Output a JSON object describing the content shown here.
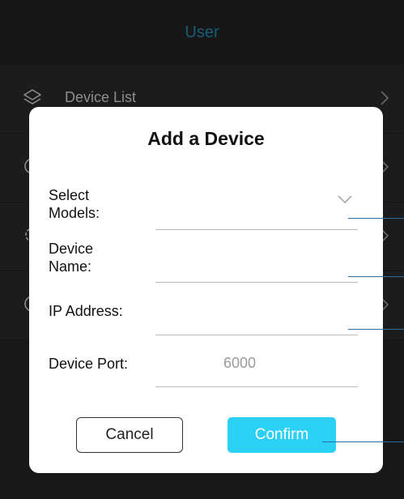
{
  "header": {
    "title": "User"
  },
  "list": {
    "items": [
      {
        "label": "Device List",
        "icon": "layers-icon"
      }
    ]
  },
  "dialog": {
    "title": "Add a Device",
    "fields": {
      "model": {
        "label": "Select Models:",
        "value": ""
      },
      "name": {
        "label": "Device Name:",
        "value": ""
      },
      "ip": {
        "label": "IP Address:",
        "value": ""
      },
      "port": {
        "label": "Device Port:",
        "placeholder": "6000"
      }
    },
    "buttons": {
      "cancel": "Cancel",
      "confirm": "Confirm"
    }
  },
  "colors": {
    "accent_title": "#2aaad6",
    "confirm_button": "#2cd0f5",
    "background_dark": "#2c2c2c",
    "leader_line": "#2a6da0"
  }
}
